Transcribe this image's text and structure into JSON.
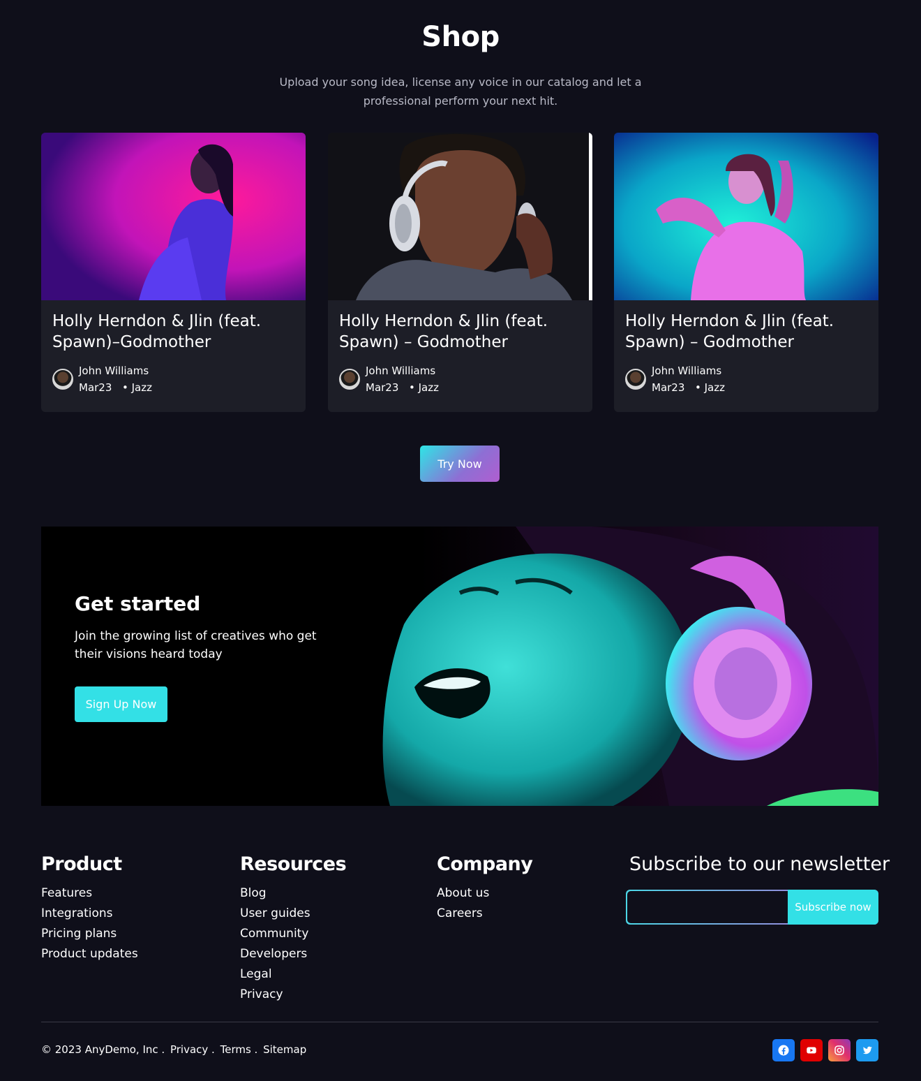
{
  "shop": {
    "title": "Shop",
    "subtitle": "Upload your song idea, license any voice in our catalog and let a professional perform your next hit."
  },
  "cards": [
    {
      "title": "Holly Herndon & Jlin (feat. Spawn)–Godmother",
      "author": "John Williams",
      "date": "Mar23",
      "genre": "• Jazz"
    },
    {
      "title": "Holly Herndon & Jlin (feat. Spawn) – Godmother",
      "author": "John Williams",
      "date": "Mar23",
      "genre": "• Jazz"
    },
    {
      "title": "Holly Herndon & Jlin (feat. Spawn) – Godmother",
      "author": "John Williams",
      "date": "Mar23",
      "genre": "• Jazz"
    }
  ],
  "try_now_label": "Try Now",
  "banner": {
    "title": "Get started",
    "text": "Join the growing list of creatives who get their visions heard today",
    "button_label": "Sign Up Now"
  },
  "footer": {
    "product": {
      "title": "Product",
      "links": [
        "Features",
        "Integrations",
        "Pricing plans",
        "Product updates"
      ]
    },
    "resources": {
      "title": "Resources",
      "links": [
        "Blog",
        "User guides",
        "Community",
        "Developers",
        "Legal",
        "Privacy"
      ]
    },
    "company": {
      "title": "Company",
      "links": [
        "About us",
        "Careers"
      ]
    },
    "newsletter": {
      "title": "Subscribe to our newsletter",
      "input_value": "",
      "button_label": "Subscribe now"
    },
    "copyright": "© 2023 AnyDemo, Inc .",
    "legal_links": [
      "Privacy .",
      "Terms .",
      "Sitemap"
    ],
    "socials": [
      {
        "icon": "facebook-icon",
        "color": "#1877f2"
      },
      {
        "icon": "youtube-icon",
        "color": "#e00000"
      },
      {
        "icon": "instagram-icon",
        "color": "#e1306c"
      },
      {
        "icon": "twitter-icon",
        "color": "#1d9bf0"
      }
    ]
  },
  "colors": {
    "background": "#0f0f1a",
    "card": "#1d1e27",
    "accent_cyan": "#33e0e6",
    "accent_purple": "#b05ed0"
  }
}
